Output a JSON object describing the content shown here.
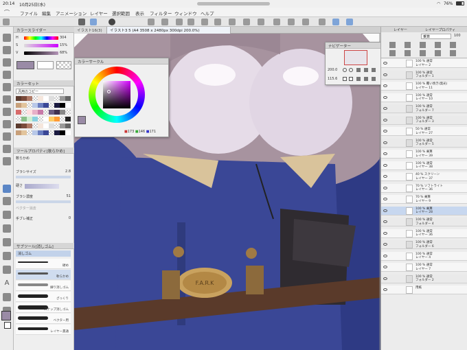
{
  "status": {
    "time": "20:14",
    "date": "10月25日(水)",
    "battery": "76%"
  },
  "menu": [
    "ファイル",
    "編集",
    "アニメーション",
    "レイヤー",
    "選択範囲",
    "表示",
    "フィルター",
    "ウィンドウ",
    "ヘルプ"
  ],
  "tabs": [
    "イラスト16(3)",
    "イラスト3 5 (A4 3508 x 2480px 300dpi 200.0%)"
  ],
  "color_slider": {
    "title": "カラースライダー",
    "rows": [
      {
        "label": "H",
        "value": "304"
      },
      {
        "label": "S",
        "value": "15%"
      },
      {
        "label": "V",
        "value": "68%"
      }
    ]
  },
  "color_set": {
    "title": "カラーセット",
    "preset": "汎用のコピー"
  },
  "tool_property": {
    "title": "ツールプロパティ[軟らかめ]",
    "tool_name": "軟らかめ",
    "brush_size_label": "ブラシサイズ",
    "brush_size_value": "2.8",
    "hardness_label": "硬さ",
    "density_label": "ブラシ濃度",
    "density_value": "51",
    "vector_eraser_label": "ベクター消去",
    "stabilization_label": "手ブレ補正",
    "stabilization_value": "0"
  },
  "sub_tool": {
    "title": "サブツール[消しゴム]",
    "group": "消しゴム",
    "brushes": [
      "硬め",
      "軟らかめ",
      "練り消しゴム",
      "ざっくり",
      "スナップ消しゴム",
      "ベクター用",
      "レイヤー貫通"
    ]
  },
  "color_circle": {
    "title": "カラーサークル",
    "r": "173",
    "g": "146",
    "b": "171"
  },
  "navigator": {
    "title": "ナビゲーター",
    "zoom": "200.0",
    "angle": "115.6"
  },
  "layer_panel": {
    "tabs": [
      "レイヤー",
      "レイヤープロパティ"
    ],
    "blend_mode": "乗算",
    "opacity": "100"
  },
  "layers": [
    {
      "mode": "100 % 通常",
      "name": "レイヤー 2",
      "type": "layer"
    },
    {
      "mode": "100 % 通常",
      "name": "フォルダー 1",
      "type": "folder"
    },
    {
      "mode": "100 % 覆い焼き(発光)",
      "name": "レイヤー 11",
      "type": "layer"
    },
    {
      "mode": "100 % 通常",
      "name": "レイヤー 10",
      "type": "layer"
    },
    {
      "mode": "100 % 通常",
      "name": "フォルダー 7",
      "type": "folder"
    },
    {
      "mode": "100 % 通常",
      "name": "フォルダー 3",
      "type": "folder"
    },
    {
      "mode": "50 % 通常",
      "name": "レイヤー 27",
      "type": "layer"
    },
    {
      "mode": "100 % 通常",
      "name": "フォルダー 5",
      "type": "folder"
    },
    {
      "mode": "100 % 乗算",
      "name": "レイヤー 39",
      "type": "layer"
    },
    {
      "mode": "100 % 通常",
      "name": "レイヤー 38",
      "type": "layer"
    },
    {
      "mode": "40 % スクリーン",
      "name": "レイヤー 37",
      "type": "layer"
    },
    {
      "mode": "70 % ソフトライト",
      "name": "レイヤー 36",
      "type": "layer"
    },
    {
      "mode": "70 % 乗算",
      "name": "レイヤー 9",
      "type": "layer"
    },
    {
      "mode": "100 % 乗算",
      "name": "レイヤー 28",
      "type": "layer"
    },
    {
      "mode": "100 % 通常",
      "name": "フォルダー 4",
      "type": "folder"
    },
    {
      "mode": "100 % 通常",
      "name": "レイヤー 36",
      "type": "layer"
    },
    {
      "mode": "100 % 通常",
      "name": "フォルダー 6",
      "type": "folder"
    },
    {
      "mode": "100 % 通常",
      "name": "レイヤー 4",
      "type": "layer"
    },
    {
      "mode": "100 % 通常",
      "name": "レイヤー 7",
      "type": "layer"
    },
    {
      "mode": "100 % 通常",
      "name": "フォルダー 2",
      "type": "folder"
    },
    {
      "mode": "",
      "name": "用紙",
      "type": "layer"
    }
  ],
  "belt_buckle_text": "F.A.R.K",
  "colors": {
    "accent": "#5b86c6",
    "selected_layer": "#c7d7ef",
    "coat": "#3a4796"
  }
}
